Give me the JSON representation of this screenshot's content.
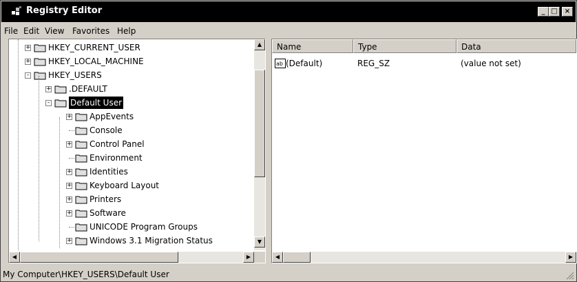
{
  "window": {
    "title": "Registry Editor",
    "icon": "regedit-icon"
  },
  "controls": {
    "minimize": "_",
    "maximize": "□",
    "close": "×"
  },
  "menu": [
    "File",
    "Edit",
    "View",
    "Favorites",
    "Help"
  ],
  "tree": {
    "nodes": [
      {
        "label": "HKEY_CURRENT_USER",
        "level": 0,
        "expander": "+",
        "selected": false
      },
      {
        "label": "HKEY_LOCAL_MACHINE",
        "level": 0,
        "expander": "+",
        "selected": false
      },
      {
        "label": "HKEY_USERS",
        "level": 0,
        "expander": "-",
        "selected": false
      },
      {
        "label": ".DEFAULT",
        "level": 1,
        "expander": "+",
        "selected": false
      },
      {
        "label": "Default User",
        "level": 1,
        "expander": "-",
        "selected": true
      },
      {
        "label": "AppEvents",
        "level": 2,
        "expander": "+",
        "selected": false
      },
      {
        "label": "Console",
        "level": 2,
        "expander": "",
        "selected": false
      },
      {
        "label": "Control Panel",
        "level": 2,
        "expander": "+",
        "selected": false
      },
      {
        "label": "Environment",
        "level": 2,
        "expander": "",
        "selected": false
      },
      {
        "label": "Identities",
        "level": 2,
        "expander": "+",
        "selected": false
      },
      {
        "label": "Keyboard Layout",
        "level": 2,
        "expander": "+",
        "selected": false
      },
      {
        "label": "Printers",
        "level": 2,
        "expander": "+",
        "selected": false
      },
      {
        "label": "Software",
        "level": 2,
        "expander": "+",
        "selected": false
      },
      {
        "label": "UNICODE Program Groups",
        "level": 2,
        "expander": "",
        "selected": false
      },
      {
        "label": "Windows 3.1 Migration Status",
        "level": 2,
        "expander": "+",
        "selected": false
      }
    ]
  },
  "list": {
    "columns": [
      "Name",
      "Type",
      "Data"
    ],
    "rows": [
      {
        "icon": "string-value-icon",
        "name": "(Default)",
        "type": "REG_SZ",
        "data": "(value not set)"
      }
    ]
  },
  "statusbar": {
    "path": "My Computer\\HKEY_USERS\\Default User"
  }
}
